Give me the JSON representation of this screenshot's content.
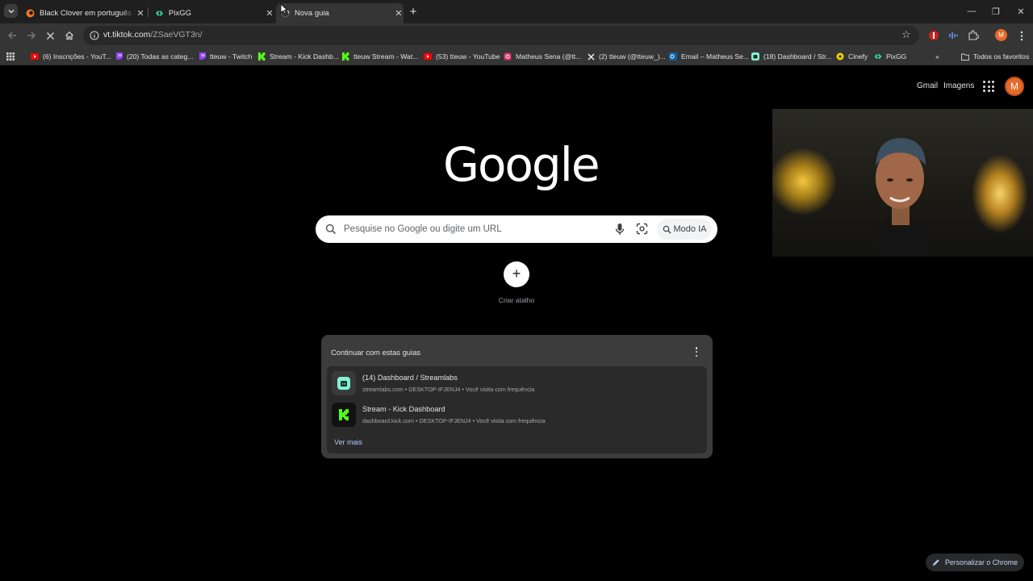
{
  "browser": {
    "tabs": [
      {
        "title": "Black Clover em português bra",
        "favicon": "crunchyroll-icon",
        "active": false
      },
      {
        "title": "PixGG",
        "favicon": "pixgg-icon",
        "active": false
      },
      {
        "title": "Nova guia",
        "favicon": "loading-icon",
        "active": true
      }
    ],
    "close_glyph": "✕",
    "new_tab_glyph": "+",
    "window": {
      "minimize": "—",
      "restore": "❐",
      "close": "✕"
    }
  },
  "toolbar": {
    "url_host": "vt.tiktok.com",
    "url_path": "/ZSaeVGT3n/"
  },
  "bookmarks": {
    "items": [
      {
        "label": "(6) Inscrições - YouT...",
        "icon": "youtube-icon",
        "color": "#ff0000"
      },
      {
        "label": "(20) Todas as categ...",
        "icon": "twitch-icon",
        "color": "#9146ff"
      },
      {
        "label": "tteuw - Twitch",
        "icon": "twitch-icon",
        "color": "#9146ff"
      },
      {
        "label": "Stream - Kick Dashb...",
        "icon": "kick-icon",
        "color": "#53fc18"
      },
      {
        "label": "tteuw Stream - Wat...",
        "icon": "kick-icon",
        "color": "#53fc18"
      },
      {
        "label": "(53) tteuw - YouTube",
        "icon": "youtube-icon",
        "color": "#ff0000"
      },
      {
        "label": "Matheus Sena (@tt...",
        "icon": "instagram-icon",
        "color": "#e1306c"
      },
      {
        "label": "(2) tteuw (@tteuw_)...",
        "icon": "x-icon",
        "color": "#ffffff"
      },
      {
        "label": "Email – Matheus Se...",
        "icon": "outlook-icon",
        "color": "#0a64ad"
      },
      {
        "label": "(18) Dashboard / Str...",
        "icon": "streamlabs-icon",
        "color": "#80f5d2"
      },
      {
        "label": "Cinefy",
        "icon": "cinefy-icon",
        "color": "#f5d000"
      },
      {
        "label": "PixGG",
        "icon": "pixgg-icon",
        "color": "#32d3a0"
      }
    ],
    "overflow_glyph": "»",
    "all_bookmarks": "Todos os favoritos"
  },
  "page": {
    "gmail": "Gmail",
    "images": "Imagens",
    "avatar_letter": "M",
    "logo": "Google",
    "search_placeholder": "Pesquise no Google ou digite um URL",
    "ai_mode": "Modo IA",
    "shortcut_plus": "+",
    "shortcut_label": "Criar atalho",
    "continue": {
      "title": "Continuar com estas guias",
      "items": [
        {
          "title": "(14) Dashboard / Streamlabs",
          "subtitle": "streamlabs.com • DESKTOP-IFJENJ4 • Você visita com frequência",
          "icon": "streamlabs-icon"
        },
        {
          "title": "Stream - Kick Dashboard",
          "subtitle": "dashboard.kick.com • DESKTOP-IFJENJ4 • Você visita com frequência",
          "icon": "kick-icon"
        }
      ],
      "see_more": "Ver mais"
    },
    "customize": "Personalizar o Chrome"
  }
}
